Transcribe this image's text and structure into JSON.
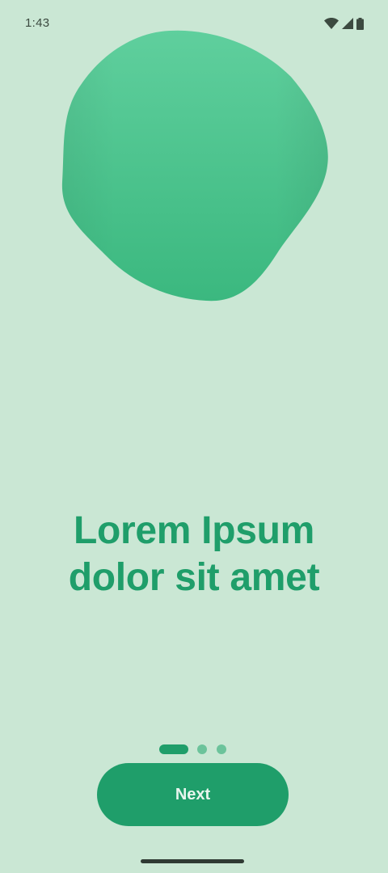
{
  "status_bar": {
    "time": "1:43",
    "icons": [
      "wifi-icon",
      "cellular-signal-icon",
      "battery-icon"
    ]
  },
  "illustration": {
    "shape": "organic-blob",
    "color": "#4fc691"
  },
  "headline": {
    "line1": "Lorem Ipsum",
    "line2": "dolor sit amet"
  },
  "pager": {
    "total_pages": 3,
    "current_page": 1
  },
  "next_button": {
    "label": "Next"
  },
  "colors": {
    "background": "#cae7d4",
    "accent": "#1f9e6a",
    "dot_inactive": "#6cc39b"
  }
}
